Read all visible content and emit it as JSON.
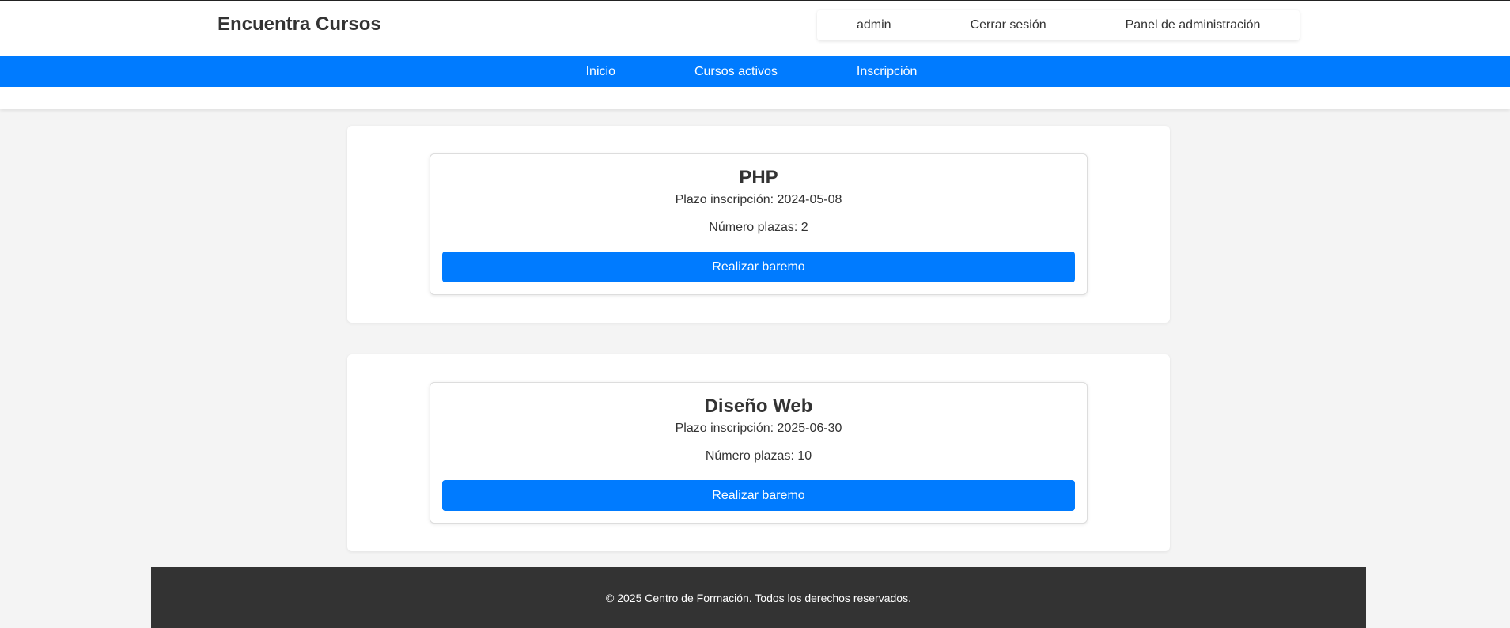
{
  "header": {
    "brand": "Encuentra Cursos",
    "user_menu": {
      "username": "admin",
      "logout": "Cerrar sesión",
      "admin_panel": "Panel de administración"
    }
  },
  "nav": {
    "items": [
      {
        "label": "Inicio"
      },
      {
        "label": "Cursos activos"
      },
      {
        "label": "Inscripción"
      }
    ]
  },
  "courses": [
    {
      "title": "PHP",
      "deadline": "Plazo inscripción: 2024-05-08",
      "seats": "Número plazas: 2",
      "button": "Realizar baremo"
    },
    {
      "title": "Diseño Web",
      "deadline": "Plazo inscripción: 2025-06-30",
      "seats": "Número plazas: 10",
      "button": "Realizar baremo"
    }
  ],
  "footer": {
    "text": "© 2025 Centro de Formación. Todos los derechos reservados."
  },
  "colors": {
    "primary": "#007bff",
    "footer_bg": "#333333",
    "page_bg": "#f4f4f4"
  }
}
